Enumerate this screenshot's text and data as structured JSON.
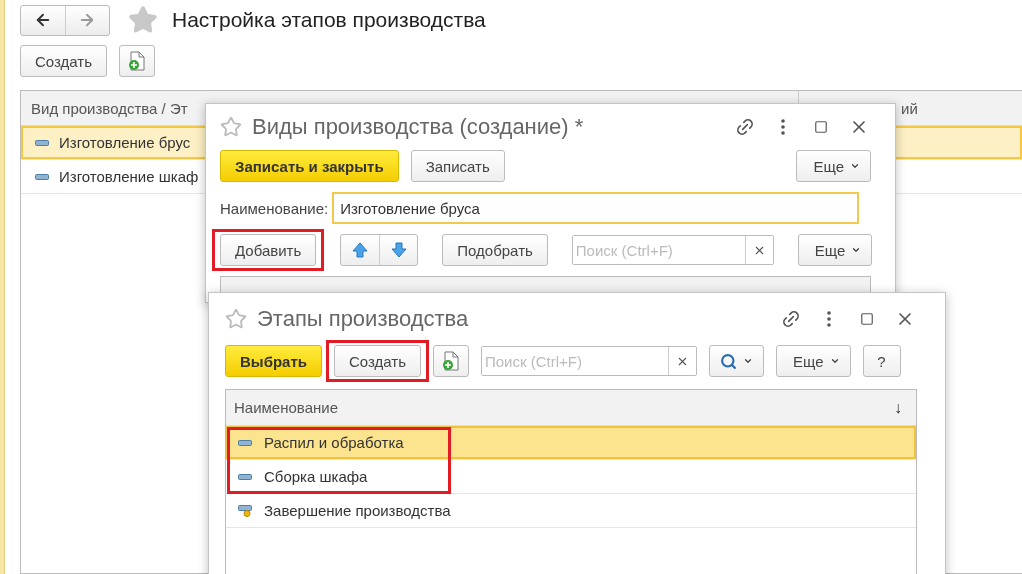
{
  "page": {
    "title": "Настройка этапов производства",
    "toolbar": [
      {
        "kind": "text",
        "label": "Создать",
        "highlighted": false
      },
      {
        "kind": "icon"
      }
    ],
    "table": {
      "columns": [
        "Вид производства / Эт",
        "ий"
      ],
      "rows": [
        {
          "label": "Изготовление брус",
          "selected": true
        },
        {
          "label": "Изготовление шкаф",
          "selected": false
        }
      ]
    }
  },
  "dialogs": [
    {
      "title": "Виды производства (создание) *",
      "toolbar": [
        {
          "kind": "primary",
          "label": "Записать и закрыть"
        },
        {
          "kind": "text",
          "label": "Записать",
          "highlighted": false
        },
        {
          "kind": "spacer"
        },
        {
          "kind": "menu",
          "label": "Еще"
        }
      ],
      "field": {
        "label": "Наименование:",
        "value": "Изготовление бруса"
      },
      "table_toolbar": [
        {
          "kind": "text",
          "label": "Добавить",
          "highlighted": true
        },
        {
          "kind": "arrows"
        },
        {
          "kind": "text",
          "label": "Подобрать",
          "highlighted": false
        },
        {
          "kind": "search",
          "placeholder": "Поиск (Ctrl+F)"
        },
        {
          "kind": "menu",
          "label": "Еще"
        }
      ]
    },
    {
      "title": "Этапы производства",
      "toolbar": [
        {
          "kind": "primary",
          "label": "Выбрать"
        },
        {
          "kind": "text",
          "label": "Создать",
          "highlighted": true
        },
        {
          "kind": "icon"
        },
        {
          "kind": "search",
          "placeholder": "Поиск (Ctrl+F)"
        },
        {
          "kind": "searchmenu"
        },
        {
          "kind": "menu",
          "label": "Еще"
        },
        {
          "kind": "text",
          "label": "?",
          "highlighted": false
        }
      ],
      "table": {
        "columns": [
          "Наименование"
        ],
        "sort": "↓",
        "rows": [
          {
            "kind": "item",
            "label": "Распил и обработка",
            "selected": true,
            "highlighted": true
          },
          {
            "kind": "item",
            "label": "Сборка шкафа",
            "selected": false,
            "highlighted": true
          },
          {
            "kind": "final",
            "label": "Завершение производства",
            "selected": false,
            "highlighted": false
          }
        ]
      }
    }
  ]
}
